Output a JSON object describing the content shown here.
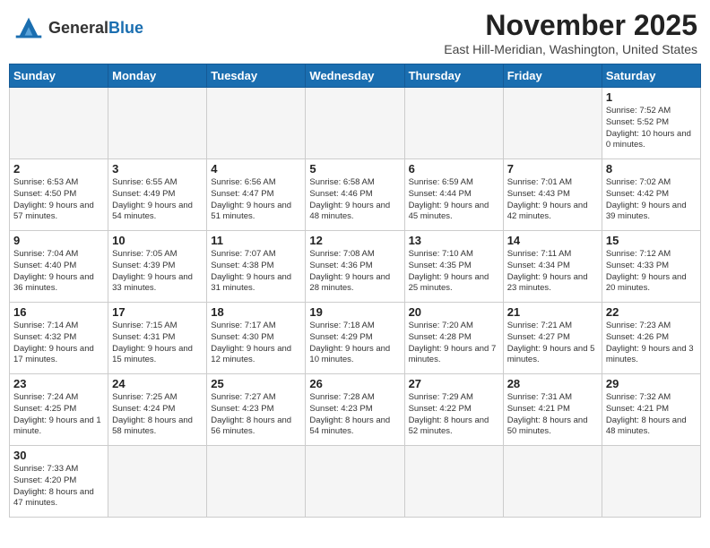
{
  "header": {
    "logo_text_general": "General",
    "logo_text_blue": "Blue",
    "month_title": "November 2025",
    "location": "East Hill-Meridian, Washington, United States"
  },
  "weekdays": [
    "Sunday",
    "Monday",
    "Tuesday",
    "Wednesday",
    "Thursday",
    "Friday",
    "Saturday"
  ],
  "weeks": [
    [
      {
        "day": "",
        "info": ""
      },
      {
        "day": "",
        "info": ""
      },
      {
        "day": "",
        "info": ""
      },
      {
        "day": "",
        "info": ""
      },
      {
        "day": "",
        "info": ""
      },
      {
        "day": "",
        "info": ""
      },
      {
        "day": "1",
        "info": "Sunrise: 7:52 AM\nSunset: 5:52 PM\nDaylight: 10 hours and 0 minutes."
      }
    ],
    [
      {
        "day": "2",
        "info": "Sunrise: 6:53 AM\nSunset: 4:50 PM\nDaylight: 9 hours and 57 minutes."
      },
      {
        "day": "3",
        "info": "Sunrise: 6:55 AM\nSunset: 4:49 PM\nDaylight: 9 hours and 54 minutes."
      },
      {
        "day": "4",
        "info": "Sunrise: 6:56 AM\nSunset: 4:47 PM\nDaylight: 9 hours and 51 minutes."
      },
      {
        "day": "5",
        "info": "Sunrise: 6:58 AM\nSunset: 4:46 PM\nDaylight: 9 hours and 48 minutes."
      },
      {
        "day": "6",
        "info": "Sunrise: 6:59 AM\nSunset: 4:44 PM\nDaylight: 9 hours and 45 minutes."
      },
      {
        "day": "7",
        "info": "Sunrise: 7:01 AM\nSunset: 4:43 PM\nDaylight: 9 hours and 42 minutes."
      },
      {
        "day": "8",
        "info": "Sunrise: 7:02 AM\nSunset: 4:42 PM\nDaylight: 9 hours and 39 minutes."
      }
    ],
    [
      {
        "day": "9",
        "info": "Sunrise: 7:04 AM\nSunset: 4:40 PM\nDaylight: 9 hours and 36 minutes."
      },
      {
        "day": "10",
        "info": "Sunrise: 7:05 AM\nSunset: 4:39 PM\nDaylight: 9 hours and 33 minutes."
      },
      {
        "day": "11",
        "info": "Sunrise: 7:07 AM\nSunset: 4:38 PM\nDaylight: 9 hours and 31 minutes."
      },
      {
        "day": "12",
        "info": "Sunrise: 7:08 AM\nSunset: 4:36 PM\nDaylight: 9 hours and 28 minutes."
      },
      {
        "day": "13",
        "info": "Sunrise: 7:10 AM\nSunset: 4:35 PM\nDaylight: 9 hours and 25 minutes."
      },
      {
        "day": "14",
        "info": "Sunrise: 7:11 AM\nSunset: 4:34 PM\nDaylight: 9 hours and 23 minutes."
      },
      {
        "day": "15",
        "info": "Sunrise: 7:12 AM\nSunset: 4:33 PM\nDaylight: 9 hours and 20 minutes."
      }
    ],
    [
      {
        "day": "16",
        "info": "Sunrise: 7:14 AM\nSunset: 4:32 PM\nDaylight: 9 hours and 17 minutes."
      },
      {
        "day": "17",
        "info": "Sunrise: 7:15 AM\nSunset: 4:31 PM\nDaylight: 9 hours and 15 minutes."
      },
      {
        "day": "18",
        "info": "Sunrise: 7:17 AM\nSunset: 4:30 PM\nDaylight: 9 hours and 12 minutes."
      },
      {
        "day": "19",
        "info": "Sunrise: 7:18 AM\nSunset: 4:29 PM\nDaylight: 9 hours and 10 minutes."
      },
      {
        "day": "20",
        "info": "Sunrise: 7:20 AM\nSunset: 4:28 PM\nDaylight: 9 hours and 7 minutes."
      },
      {
        "day": "21",
        "info": "Sunrise: 7:21 AM\nSunset: 4:27 PM\nDaylight: 9 hours and 5 minutes."
      },
      {
        "day": "22",
        "info": "Sunrise: 7:23 AM\nSunset: 4:26 PM\nDaylight: 9 hours and 3 minutes."
      }
    ],
    [
      {
        "day": "23",
        "info": "Sunrise: 7:24 AM\nSunset: 4:25 PM\nDaylight: 9 hours and 1 minute."
      },
      {
        "day": "24",
        "info": "Sunrise: 7:25 AM\nSunset: 4:24 PM\nDaylight: 8 hours and 58 minutes."
      },
      {
        "day": "25",
        "info": "Sunrise: 7:27 AM\nSunset: 4:23 PM\nDaylight: 8 hours and 56 minutes."
      },
      {
        "day": "26",
        "info": "Sunrise: 7:28 AM\nSunset: 4:23 PM\nDaylight: 8 hours and 54 minutes."
      },
      {
        "day": "27",
        "info": "Sunrise: 7:29 AM\nSunset: 4:22 PM\nDaylight: 8 hours and 52 minutes."
      },
      {
        "day": "28",
        "info": "Sunrise: 7:31 AM\nSunset: 4:21 PM\nDaylight: 8 hours and 50 minutes."
      },
      {
        "day": "29",
        "info": "Sunrise: 7:32 AM\nSunset: 4:21 PM\nDaylight: 8 hours and 48 minutes."
      }
    ],
    [
      {
        "day": "30",
        "info": "Sunrise: 7:33 AM\nSunset: 4:20 PM\nDaylight: 8 hours and 47 minutes."
      },
      {
        "day": "",
        "info": ""
      },
      {
        "day": "",
        "info": ""
      },
      {
        "day": "",
        "info": ""
      },
      {
        "day": "",
        "info": ""
      },
      {
        "day": "",
        "info": ""
      },
      {
        "day": "",
        "info": ""
      }
    ]
  ]
}
